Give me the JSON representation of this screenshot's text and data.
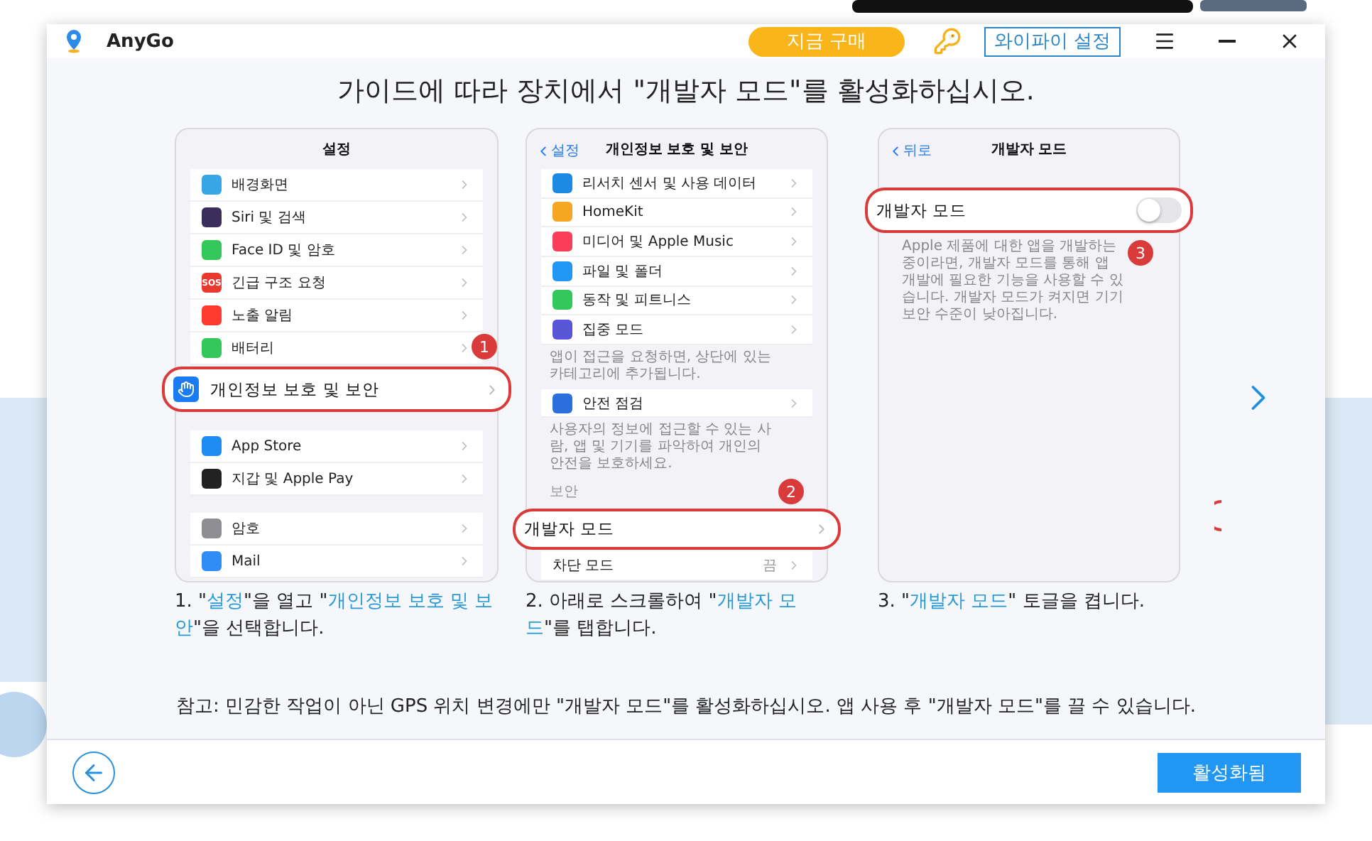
{
  "window": {
    "app_name": "AnyGo",
    "buy_button": "지금 구매",
    "wifi_button": "와이파이 설정"
  },
  "heading": "가이드에 따라 장치에서 \"개발자 모드\"를 활성화하십시오.",
  "steps": [
    {
      "screen": {
        "title": "설정",
        "items": [
          {
            "kind": "row",
            "label": "배경화면",
            "color": "#37a5e6"
          },
          {
            "kind": "row",
            "label": "Siri 및 검색",
            "color": "#3a2f5c"
          },
          {
            "kind": "row",
            "label": "Face ID 및 암호",
            "color": "#34c759"
          },
          {
            "kind": "row",
            "label": "긴급 구조 요청",
            "color": "#e8392f",
            "badge": "SOS"
          },
          {
            "kind": "row",
            "label": "노출 알림",
            "color": "#ff3b30"
          },
          {
            "kind": "row",
            "label": "배터리",
            "color": "#34c759"
          },
          {
            "kind": "callout",
            "text": "1"
          },
          {
            "kind": "highlight",
            "label": "개인정보 보호 및 보안",
            "color": "#1a7cf0"
          },
          {
            "kind": "gap"
          },
          {
            "kind": "row",
            "label": "App Store",
            "color": "#1e8cf2"
          },
          {
            "kind": "row",
            "label": "지갑 및 Apple Pay",
            "color": "#222222"
          },
          {
            "kind": "gap"
          },
          {
            "kind": "row",
            "label": "암호",
            "color": "#8e8e93"
          },
          {
            "kind": "row",
            "label": "Mail",
            "color": "#2f8df5"
          }
        ]
      },
      "caption": [
        {
          "text": "1. \""
        },
        {
          "text": "설정",
          "term": true
        },
        {
          "text": "\"을 열고 \""
        },
        {
          "text": "개인정보 보호 및 보안",
          "term": true
        },
        {
          "text": "\"을 선택합니다."
        }
      ]
    },
    {
      "screen": {
        "back": "설정",
        "title": "개인정보 보호 및 보안",
        "items": [
          {
            "kind": "row",
            "label": "리서치 센서 및 사용 데이터",
            "color": "#1e88e5"
          },
          {
            "kind": "row",
            "label": "HomeKit",
            "color": "#f5a623"
          },
          {
            "kind": "row",
            "label": "미디어 및 Apple Music",
            "color": "#fa3e5a"
          },
          {
            "kind": "row",
            "label": "파일 및 폴더",
            "color": "#2196f3"
          },
          {
            "kind": "row",
            "label": "동작 및 피트니스",
            "color": "#34c759"
          },
          {
            "kind": "row",
            "label": "집중 모드",
            "color": "#5856d6"
          },
          {
            "kind": "note",
            "text": "앱이 접근을 요청하면, 상단에 있는 카테고리에 추가됩니다."
          },
          {
            "kind": "row",
            "label": "안전 점검",
            "color": "#2a6fdb"
          },
          {
            "kind": "note",
            "text": "사용자의 정보에 접근할 수 있는 사람, 앱 및 기기를 파악하여 개인의 안전을 보호하세요."
          },
          {
            "kind": "section",
            "text": "보안",
            "callout": "2"
          },
          {
            "kind": "highlight",
            "label": "개발자 모드"
          },
          {
            "kind": "row",
            "label": "차단 모드",
            "value": "끔"
          }
        ]
      },
      "caption": [
        {
          "text": "2. 아래로 스크롤하여 \""
        },
        {
          "text": "개발자 모드",
          "term": true
        },
        {
          "text": "\"를 탭합니다."
        }
      ]
    },
    {
      "screen": {
        "back": "뒤로",
        "title": "개발자 모드",
        "items": [
          {
            "kind": "gap"
          },
          {
            "kind": "highlight",
            "label": "개발자 모드",
            "on": false
          },
          {
            "kind": "callout",
            "text": "3"
          },
          {
            "kind": "note",
            "text": "Apple 제품에 대한 앱을 개발하는 중이라면, 개발자 모드를 통해 앱 개발에 필요한 기능을 사용할 수 있습니다. 개발자 모드가 켜지면 기기 보안 수준이 낮아집니다."
          }
        ]
      },
      "caption": [
        {
          "text": "3. \""
        },
        {
          "text": "개발자 모드",
          "term": true
        },
        {
          "text": "\" 토글을 켭니다."
        }
      ]
    }
  ],
  "note": "참고: 민감한 작업이 아닌 GPS 위치 변경에만 \"개발자 모드\"를 활성화하십시오. 앱 사용 후 \"개발자 모드\"를 끌 수 있습니다.",
  "activate_button": "활성화됨"
}
